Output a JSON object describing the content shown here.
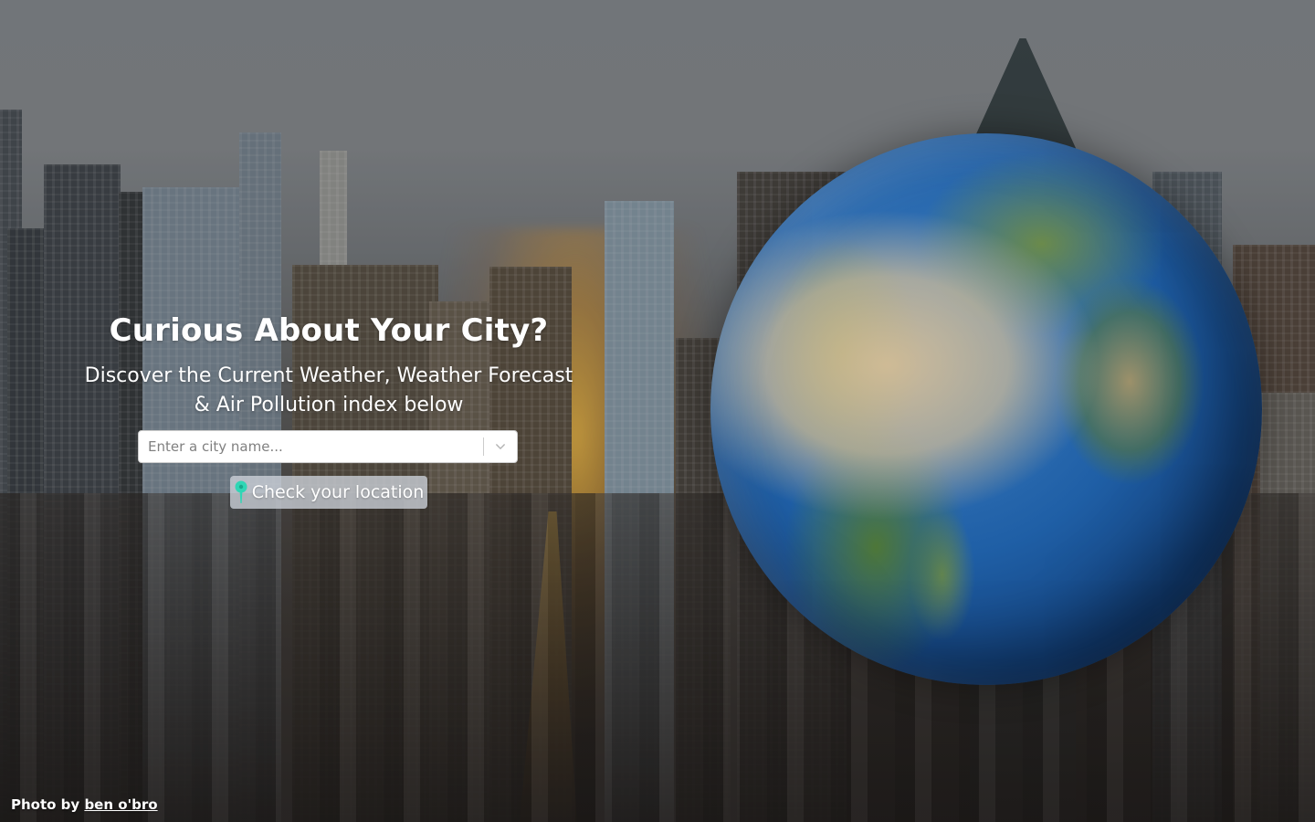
{
  "hero": {
    "title": "Curious About Your City?",
    "subtitle_line1": "Discover the Current Weather, Weather Forecast",
    "subtitle_line2": "& Air Pollution index below"
  },
  "search": {
    "placeholder": "Enter a city name...",
    "value": ""
  },
  "location_button": {
    "label": "Check your location",
    "icon": "map-pin-icon",
    "icon_color": "#2fd6b5"
  },
  "credit": {
    "prefix": "Photo by",
    "author": "ben o'bro"
  },
  "colors": {
    "text": "#ffffff",
    "button_bg": "#cdd2da"
  }
}
